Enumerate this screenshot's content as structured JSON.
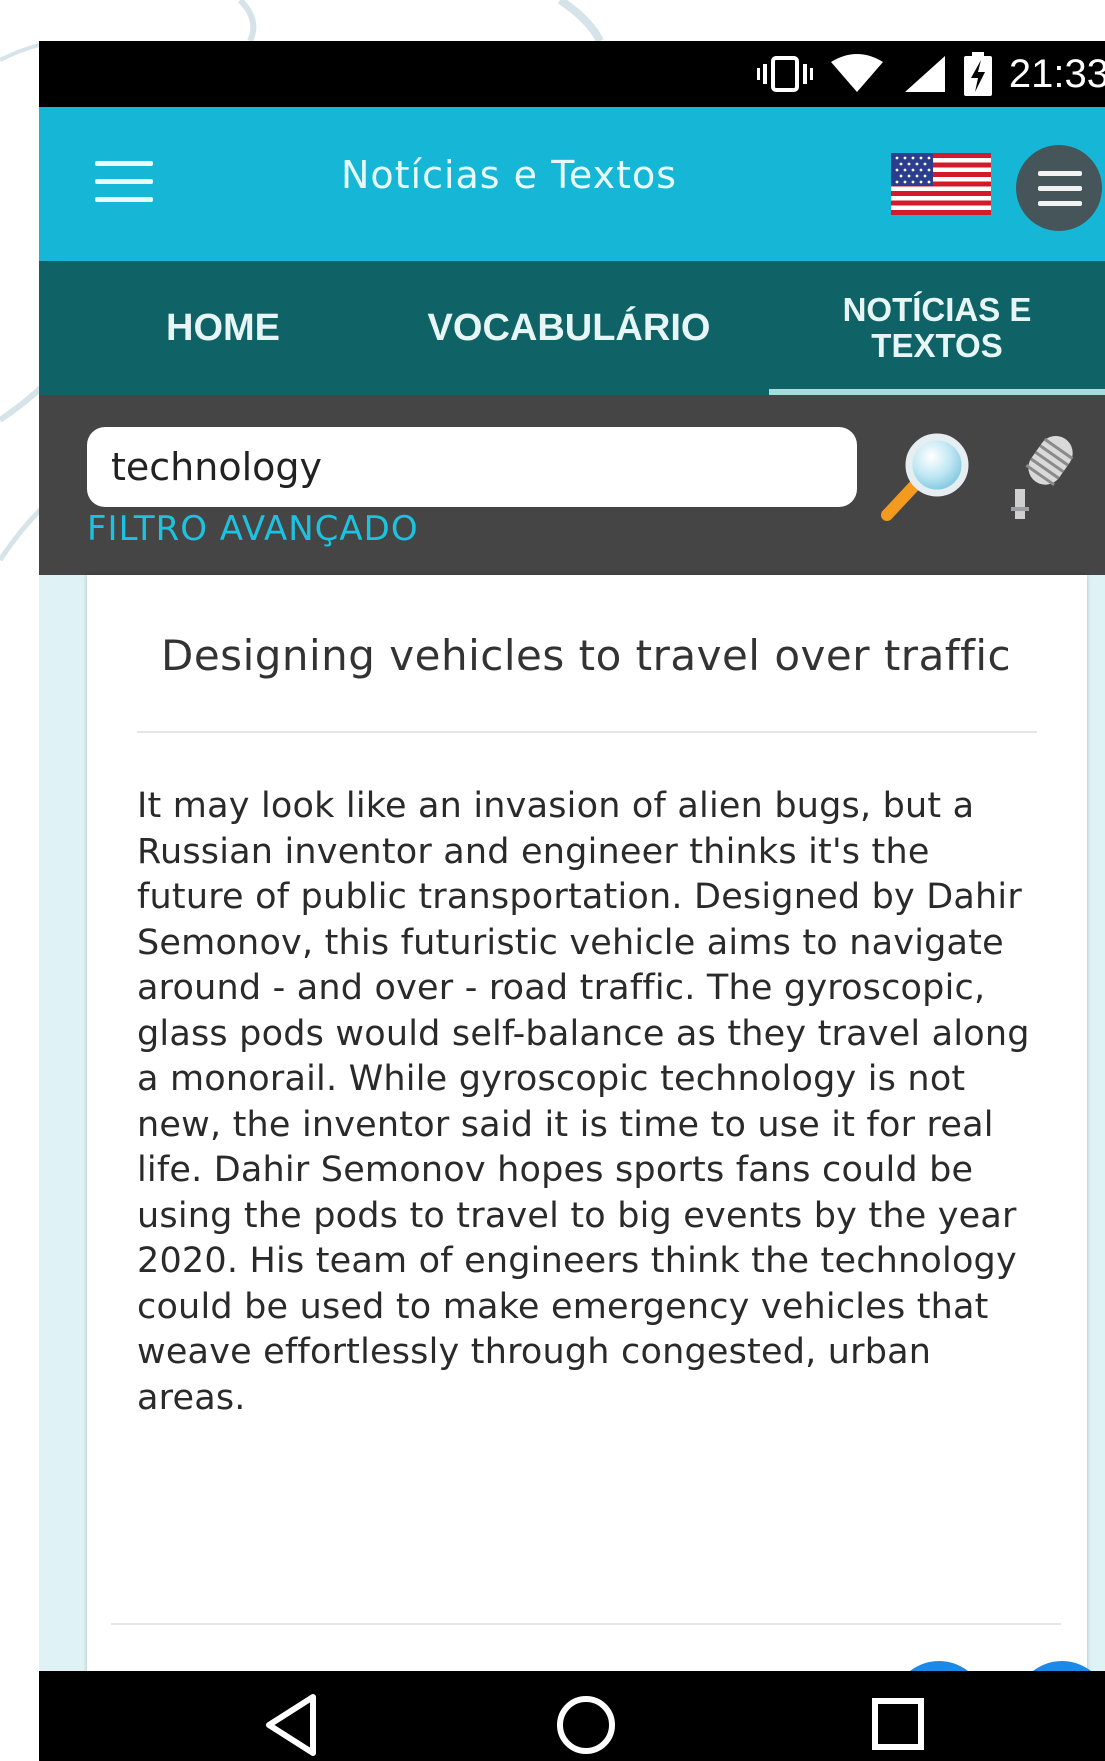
{
  "status_bar": {
    "time": "21:33",
    "icons": [
      "vibrate-icon",
      "wifi-icon",
      "signal-icon",
      "battery-charging-icon"
    ]
  },
  "app_bar": {
    "title": "Notícias e Textos",
    "menu_icon": "hamburger-icon",
    "language_icon": "us-flag-icon",
    "options_icon": "menu-circle-icon"
  },
  "tabs": [
    {
      "label": "HOME",
      "active": false
    },
    {
      "label": "VOCABULÁRIO",
      "active": false
    },
    {
      "label": "NOTÍCIAS E TEXTOS",
      "active": true
    }
  ],
  "search": {
    "value": "technology",
    "advanced_filter_label": "FILTRO AVANÇADO",
    "search_icon": "magnifier-icon",
    "voice_icon": "microphone-icon"
  },
  "article": {
    "title": "Designing vehicles to travel over traffic",
    "body": "It may look like an invasion of alien bugs, but a Russian inventor and engineer thinks it's the future of public transportation. Designed by Dahir Semonov, this futuristic vehicle aims to navigate around - and over - road traffic. The gyroscopic, glass pods would self-balance as they travel along a monorail. While gyroscopic technology is not new, the inventor said it is time to use it for real life. Dahir Semonov hopes sports fans could be using the pods to travel to big events by the year 2020. His team of engineers think the technology could be used to make emergency vehicles that weave effortlessly through congested, urban areas."
  },
  "nav_bar": {
    "icons": [
      "back-icon",
      "home-icon",
      "recents-icon"
    ]
  },
  "colors": {
    "app_bar": "#16b7d6",
    "tab_bar": "#0f6367",
    "search_area": "#454545",
    "accent": "#1cc3e0",
    "background": "#dff3f6"
  }
}
